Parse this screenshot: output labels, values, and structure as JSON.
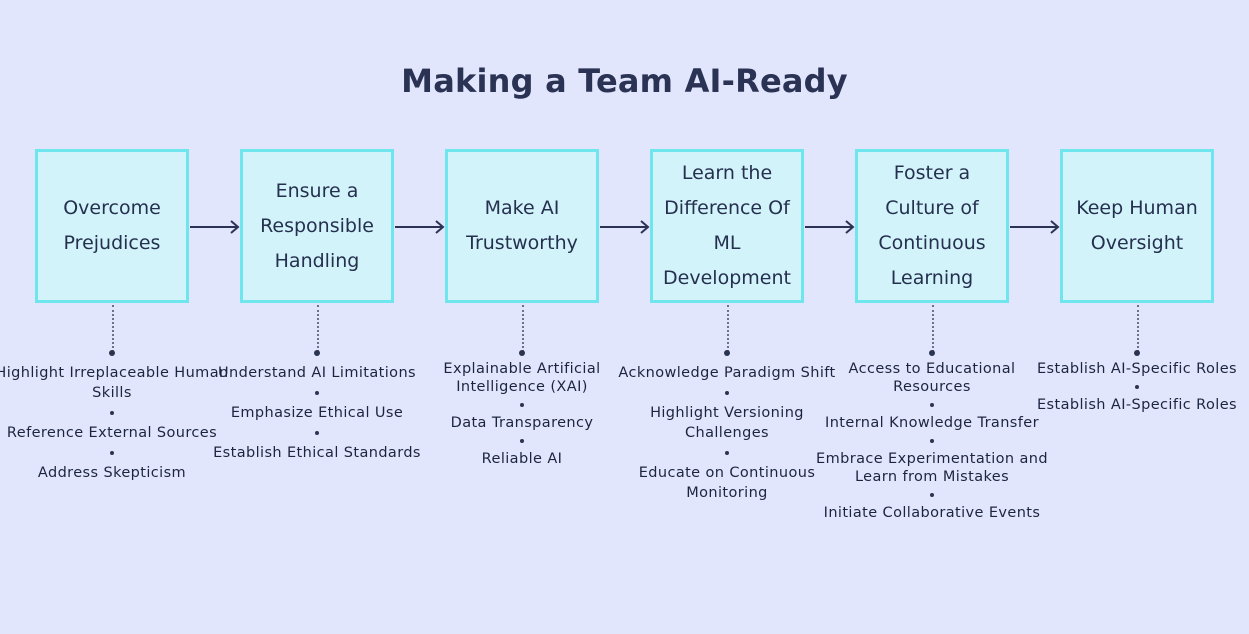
{
  "title": "Making a Team AI-Ready",
  "steps": [
    {
      "lines": [
        "Overcome",
        "Prejudices"
      ],
      "items": [
        "Highlight Irreplaceable Human Skills",
        "Reference External Sources",
        "Address Skepticism"
      ]
    },
    {
      "lines": [
        "Ensure a",
        "Responsible",
        "Handling"
      ],
      "items": [
        "Understand AI Limitations",
        "Emphasize Ethical Use",
        "Establish Ethical Standards"
      ]
    },
    {
      "lines": [
        "Make AI",
        "Trustworthy"
      ],
      "items": [
        "Explainable Artificial Intelligence (XAI)",
        "Data Transparency",
        "Reliable AI"
      ]
    },
    {
      "lines": [
        "Learn the",
        "Difference Of",
        "ML",
        "Development"
      ],
      "items": [
        "Acknowledge Paradigm Shift",
        "Highlight Versioning Challenges",
        "Educate on Continuous Monitoring"
      ]
    },
    {
      "lines": [
        "Foster a",
        "Culture of",
        "Continuous",
        "Learning"
      ],
      "items": [
        "Access to Educational Resources",
        "Internal Knowledge Transfer",
        "Embrace Experimentation and Learn from Mistakes",
        "Initiate Collaborative Events"
      ]
    },
    {
      "lines": [
        "Keep Human",
        "Oversight"
      ],
      "items": [
        "Establish AI-Specific Roles",
        "Establish AI-Specific Roles"
      ]
    }
  ],
  "colors": {
    "background": "#e2e6fc",
    "box_fill": "#d3f3fb",
    "box_border": "#6fe5ee",
    "text": "#1e2a48"
  }
}
